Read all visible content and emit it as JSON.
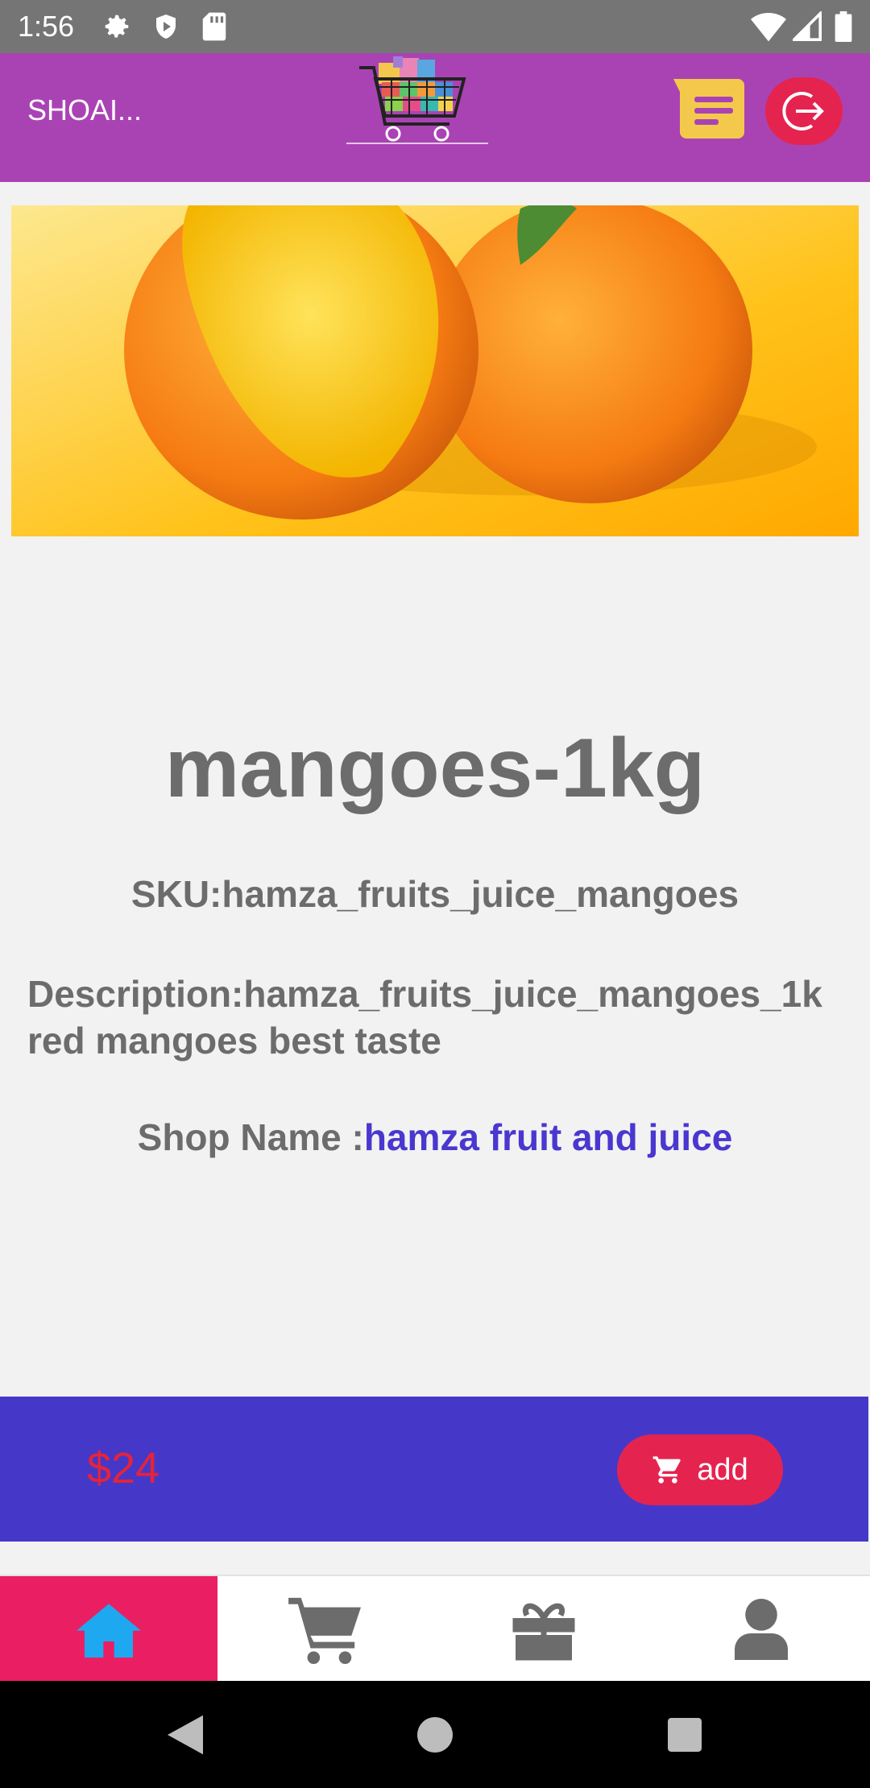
{
  "status_bar": {
    "time": "1:56",
    "icons": [
      "gear-icon",
      "shield-icon",
      "sd-card-icon",
      "wifi-icon",
      "signal-icon",
      "battery-icon"
    ]
  },
  "app_bar": {
    "user_name": "SHOAI...",
    "color": "#a943b4",
    "logo": "shopping-cart-logo",
    "actions": [
      "notes-icon",
      "logout-icon"
    ]
  },
  "product": {
    "banner": "mango-image",
    "title": "mangoes-1kg",
    "sku": "SKU:hamza_fruits_juice_mangoes",
    "description": "Description:hamza_fruits_juice_mangoes_1k red mangoes best taste",
    "shop_label": "Shop Name :",
    "shop_name": "hamza fruit and juice"
  },
  "purchase": {
    "price": "$24",
    "add_label": "add",
    "bar_color": "#4538c8",
    "button_color": "#e5234f"
  },
  "bottom_nav": {
    "items": [
      {
        "icon": "home-icon",
        "active": true
      },
      {
        "icon": "cart-icon",
        "active": false
      },
      {
        "icon": "gift-icon",
        "active": false
      },
      {
        "icon": "user-icon",
        "active": false
      }
    ],
    "active_color": "#ea1f63"
  },
  "system_nav": [
    "back-icon",
    "home-circle-icon",
    "recents-icon"
  ]
}
